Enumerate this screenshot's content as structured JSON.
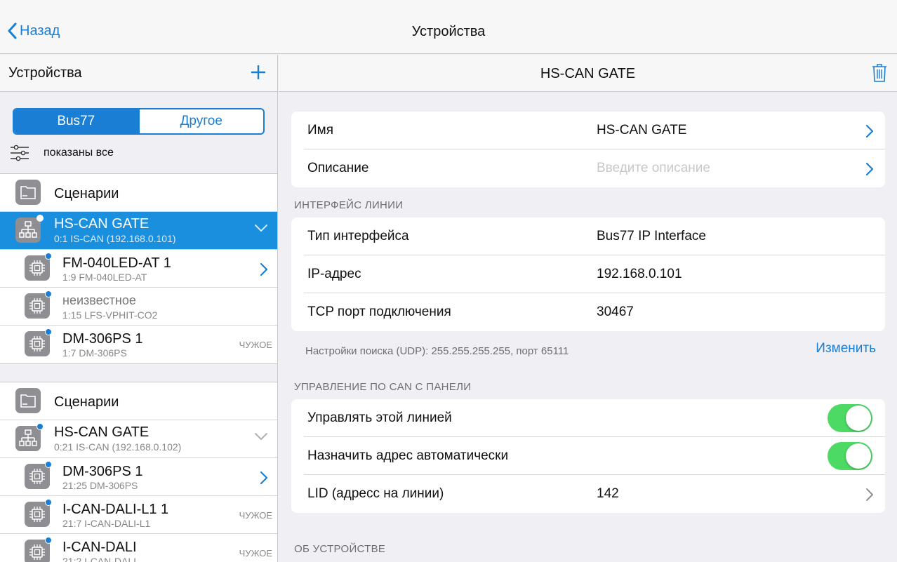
{
  "nav": {
    "back_label": "Назад",
    "title": "Устройства"
  },
  "left": {
    "title": "Устройства",
    "segments": [
      "Bus77",
      "Другое"
    ],
    "filter_label": "показаны все",
    "groups": [
      {
        "items": [
          {
            "title": "Сценарии",
            "subtitle": ""
          },
          {
            "title": "HS-CAN GATE",
            "subtitle": "0:1 IS-CAN (192.168.0.101)"
          },
          {
            "title": "FM-040LED-AT 1",
            "subtitle": "1:9 FM-040LED-AT"
          },
          {
            "title": "неизвестное",
            "subtitle": "1:15 LFS-VPHIT-CO2"
          },
          {
            "title": "DM-306PS 1",
            "subtitle": "1:7 DM-306PS",
            "tag": "ЧУЖОЕ"
          }
        ]
      },
      {
        "items": [
          {
            "title": "Сценарии",
            "subtitle": ""
          },
          {
            "title": "HS-CAN GATE",
            "subtitle": "0:21 IS-CAN (192.168.0.102)"
          },
          {
            "title": "DM-306PS 1",
            "subtitle": "21:25 DM-306PS"
          },
          {
            "title": "I-CAN-DALI-L1 1",
            "subtitle": "21:7 I-CAN-DALI-L1",
            "tag": "ЧУЖОЕ"
          },
          {
            "title": "I-CAN-DALI",
            "subtitle": "21:2 I-CAN-DALI",
            "tag": "ЧУЖОЕ"
          }
        ]
      }
    ]
  },
  "right": {
    "title": "HS-CAN GATE",
    "general": [
      {
        "label": "Имя",
        "value": "HS-CAN GATE"
      },
      {
        "label": "Описание",
        "placeholder": "Введите описание"
      }
    ],
    "interface_section": "ИНТЕРФЕЙС ЛИНИИ",
    "interface": [
      {
        "label": "Тип интерфейса",
        "value": "Bus77 IP Interface"
      },
      {
        "label": "IP-адрес",
        "value": "192.168.0.101"
      },
      {
        "label": "TCP порт подключения",
        "value": "30467"
      }
    ],
    "search_note": "Настройки поиска (UDP): 255.255.255.255, порт 65111",
    "change_label": "Изменить",
    "can_section": "УПРАВЛЕНИЕ ПО CAN С ПАНЕЛИ",
    "can": [
      {
        "label": "Управлять этой линией",
        "toggle": true
      },
      {
        "label": "Назначить адрес автоматически",
        "toggle": true
      },
      {
        "label": "LID (адресс на линии)",
        "value": "142"
      }
    ],
    "about_section": "ОБ УСТРОЙСТВЕ"
  },
  "colors": {
    "accent": "#1a7fd4",
    "selected_row": "#1a8fde",
    "toggle_on": "#4cd964",
    "icon_bg": "#8e8e93"
  },
  "icons": [
    "chevron-left-icon",
    "plus-icon",
    "filter-sliders-icon",
    "folder-icon",
    "network-icon",
    "chip-icon",
    "chevron-down-icon",
    "chevron-right-icon",
    "trash-icon"
  ]
}
